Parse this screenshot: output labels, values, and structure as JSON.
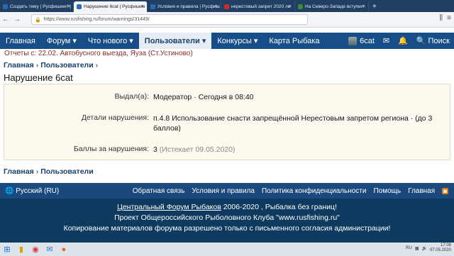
{
  "browser_tabs": [
    {
      "title": "Создать тему | Русфишинг! |",
      "fav_color": "#2b6ab0",
      "active": false
    },
    {
      "title": "Нарушение 6cat | Русфишин",
      "fav_color": "#2b6ab0",
      "active": true
    },
    {
      "title": "Условия и правила | Русфиш",
      "fav_color": "#2b6ab0",
      "active": false
    },
    {
      "title": "нерестовый запрет 2020 ле",
      "fav_color": "#d12a2a",
      "active": false
    },
    {
      "title": "На Северо-Западе вступил",
      "fav_color": "#3a8a3a",
      "active": false
    }
  ],
  "browser": {
    "url": "https://www.rusfishing.ru/forum/warnings/31449/",
    "new_tab": "+"
  },
  "site_nav": {
    "items": [
      "Главная",
      "Форум ▾",
      "Что нового ▾",
      "Пользователи ▾",
      "Конкурсы ▾",
      "Карта Рыбака"
    ],
    "active_index": 3,
    "user": "6cat",
    "search": "Поиск"
  },
  "notice": {
    "prefix": "Отчеты с:",
    "text": " 22.02. Автобусного выезда, Яуза (Ст.Устиново)"
  },
  "breadcrumb": {
    "home": "Главная",
    "sep": "›",
    "section": "Пользователи",
    "chevron": "›"
  },
  "page_title": "Нарушение 6cat",
  "details": {
    "issued_by_label": "Выдал(а):",
    "issued_by_value": "Модератор · Сегодня в 08:40",
    "violation_label": "Детали нарушения:",
    "violation_value": "п.4.8 Использование снасти запрещённой Нерестовым запретом региона · (до 3 баллов)",
    "points_label": "Баллы за нарушения:",
    "points_value": "3",
    "points_expiry": "(Истекает 09.05.2020)"
  },
  "footer": {
    "language": "🌐 Русский (RU)",
    "links": [
      "Обратная связь",
      "Условия и правила",
      "Политика конфиденциальности",
      "Помощь",
      "Главная"
    ],
    "line1_link": "Центральный Форум Рыбаков",
    "line1_rest": " 2006-2020 , Рыбалка без границ!",
    "line2": "Проект Общероссийского Рыболовного Клуба \"www.rusfishing.ru\"",
    "line3": "Копирование материалов форума разрешено только с письменного согласия администрации!"
  },
  "taskbar": {
    "lang": "RU",
    "time": "17:08",
    "date": "07.05.2020"
  }
}
